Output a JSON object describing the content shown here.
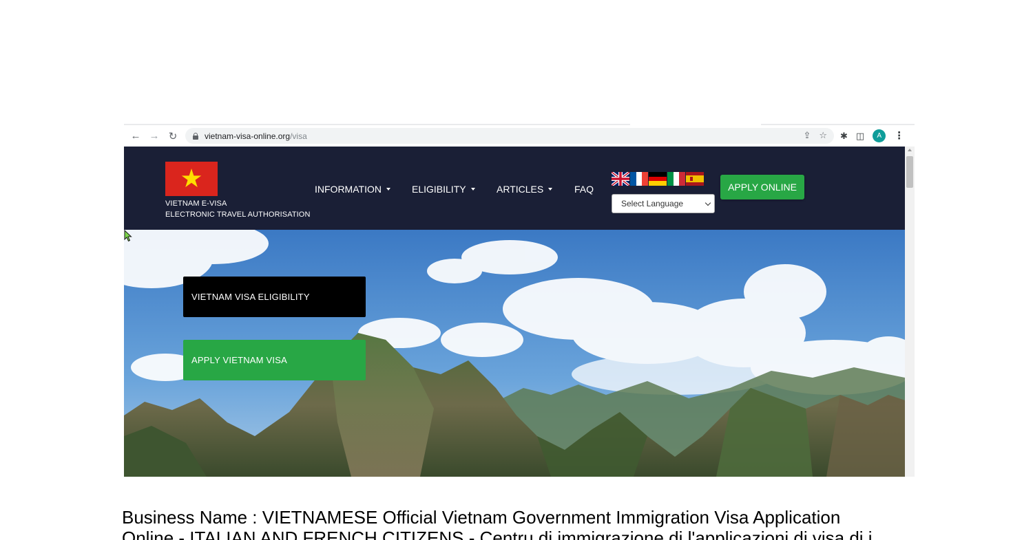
{
  "browser": {
    "url_domain": "vietnam-visa-online.org",
    "url_path": "/visa",
    "avatar_letter": "A"
  },
  "site": {
    "brand_line1": "VIETNAM E-VISA",
    "brand_line2": "ELECTRONIC TRAVEL AUTHORISATION",
    "nav": [
      {
        "label": "INFORMATION",
        "dropdown": true
      },
      {
        "label": "ELIGIBILITY",
        "dropdown": true
      },
      {
        "label": "ARTICLES",
        "dropdown": true
      },
      {
        "label": "FAQ",
        "dropdown": false
      }
    ],
    "language_flags": [
      "uk-flag-icon",
      "france-flag-icon",
      "germany-flag-icon",
      "italy-flag-icon",
      "spain-flag-icon"
    ],
    "language_select": "Select Language",
    "apply_online": "APPLY ONLINE",
    "hero_eligibility": "VIETNAM VISA ELIGIBILITY",
    "hero_apply": "APPLY VIETNAM VISA",
    "colors": {
      "header_bg": "#1a1f36",
      "accent_green": "#28a745",
      "flag_red": "#da251d",
      "star_yellow": "#ffde00"
    }
  },
  "caption": {
    "line1": "Business Name : VIETNAMESE Official Vietnam Government Immigration Visa Application",
    "line2": "Online - ITALIAN AND FRENCH CITIZENS - Centru di immigrazione di l'applicazioni di visa di i"
  }
}
